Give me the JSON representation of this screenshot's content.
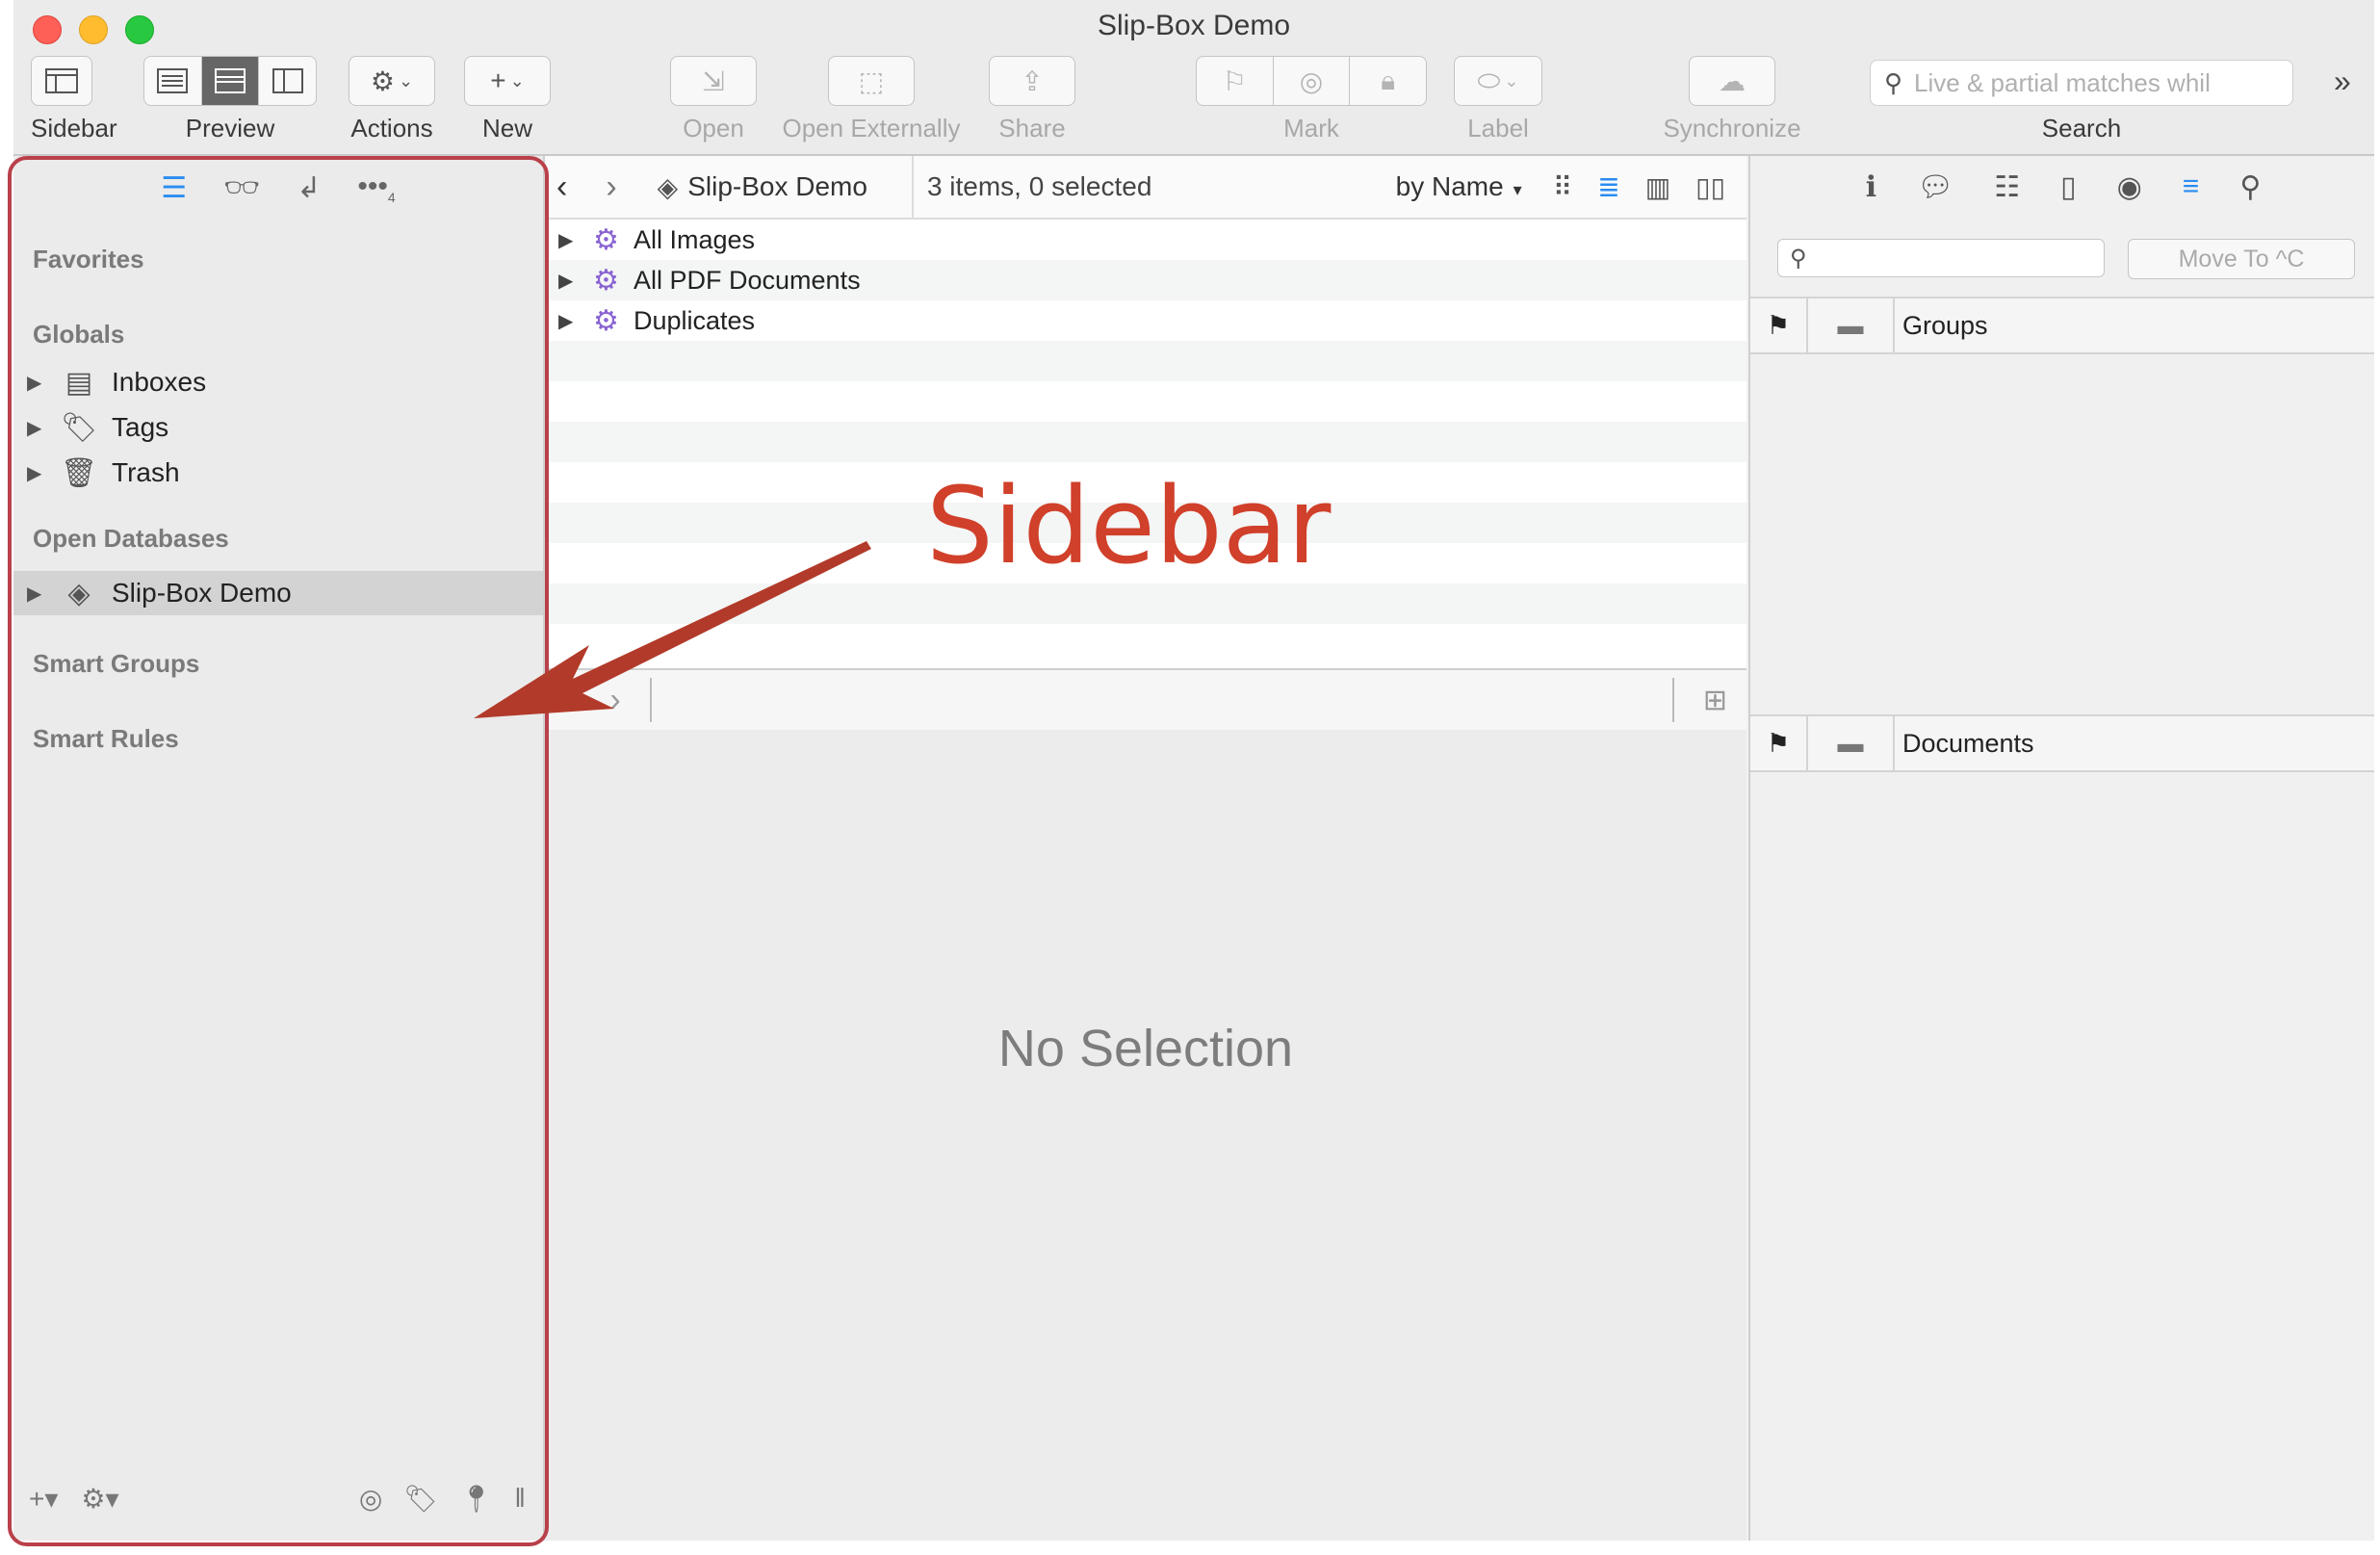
{
  "window": {
    "title": "Slip-Box Demo"
  },
  "toolbar": {
    "sidebar_label": "Sidebar",
    "preview_label": "Preview",
    "actions_label": "Actions",
    "new_label": "New",
    "open_label": "Open",
    "open_externally_label": "Open Externally",
    "share_label": "Share",
    "mark_label": "Mark",
    "label_label": "Label",
    "synchronize_label": "Synchronize",
    "search_label": "Search",
    "search_placeholder": "Live & partial matches whil"
  },
  "sidebar": {
    "sections": {
      "favorites": "Favorites",
      "globals": "Globals",
      "open_databases": "Open Databases",
      "smart_groups": "Smart Groups",
      "smart_rules": "Smart Rules"
    },
    "globals": [
      {
        "label": "Inboxes",
        "icon": "inbox-icon"
      },
      {
        "label": "Tags",
        "icon": "tag-icon"
      },
      {
        "label": "Trash",
        "icon": "trash-icon"
      }
    ],
    "databases": [
      {
        "label": "Slip-Box Demo",
        "icon": "database-stack-icon",
        "selected": true
      }
    ],
    "more_badge": "4"
  },
  "center": {
    "breadcrumb": "Slip-Box Demo",
    "status": "3 items, 0 selected",
    "sort": "by Name",
    "items": [
      {
        "label": "All Images",
        "icon": "smart-group-gear-icon"
      },
      {
        "label": "All PDF Documents",
        "icon": "smart-group-gear-icon"
      },
      {
        "label": "Duplicates",
        "icon": "smart-group-gear-icon"
      }
    ],
    "no_selection": "No Selection"
  },
  "inspector": {
    "move_to_label": "Move To ^C",
    "groups_header": "Groups",
    "documents_header": "Documents"
  },
  "annotation": {
    "text": "Sidebar",
    "color": "#d0402a",
    "box_color": "#b9404a"
  },
  "colors": {
    "accent": "#2a8cf0",
    "smart_group": "#8a63d2",
    "selection": "#d3d3d3"
  }
}
